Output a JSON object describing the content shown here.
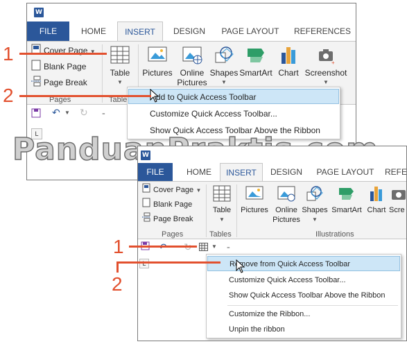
{
  "app_logo": "W",
  "tabs": [
    "FILE",
    "HOME",
    "INSERT",
    "DESIGN",
    "PAGE LAYOUT",
    "REFERENCES"
  ],
  "tabs_short_last": "REFE",
  "pages_group": {
    "label": "Pages",
    "cover_page": "Cover Page",
    "blank_page": "Blank Page",
    "page_break": "Page Break"
  },
  "tables_group": {
    "label": "Tables",
    "label_cut": "Table",
    "table": "Table"
  },
  "illustrations_group": {
    "label": "Illustrations",
    "pictures": "Pictures",
    "online_pictures_1": "Online",
    "online_pictures_2": "Pictures",
    "shapes": "Shapes",
    "smartart": "SmartArt",
    "chart": "Chart",
    "screenshot": "Screenshot",
    "screenshot_cut": "Scre"
  },
  "menu1": {
    "add": "Add to Quick Access Toolbar",
    "customize": "Customize Quick Access Toolbar...",
    "show_above": "Show Quick Access Toolbar Above the Ribbon"
  },
  "menu2": {
    "remove": "Remove from Quick Access Toolbar",
    "customize": "Customize Quick Access Toolbar...",
    "show_above": "Show Quick Access Toolbar Above the Ribbon",
    "customize_ribbon": "Customize the Ribbon...",
    "unpin": "Unpin the ribbon"
  },
  "ruler_marker": "L",
  "callouts": {
    "one": "1",
    "two": "2"
  },
  "watermark": "PanduanPraktis.com",
  "colors": {
    "file_tab": "#2b579a",
    "highlight": "#cde6f7",
    "callout": "#e2502e"
  }
}
